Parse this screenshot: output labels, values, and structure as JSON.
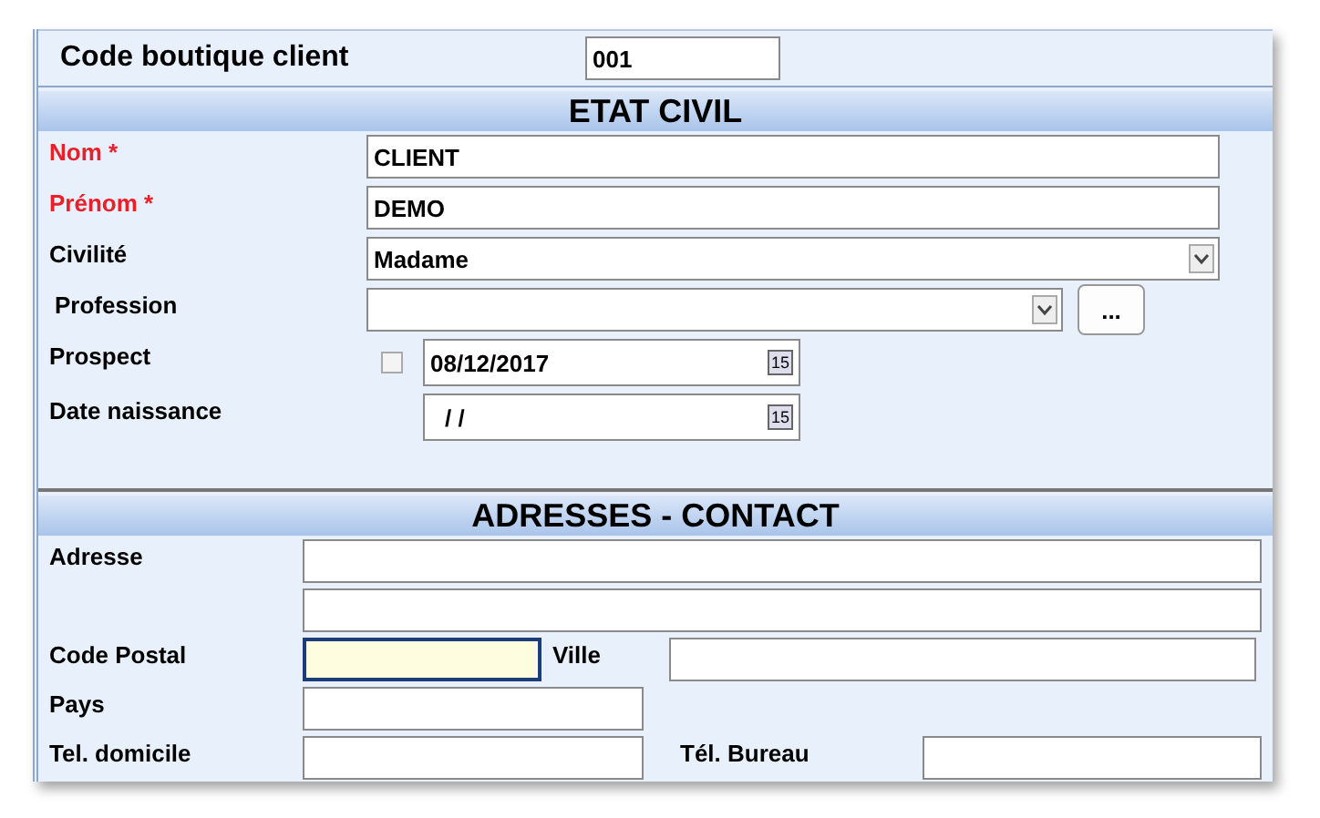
{
  "shop_code": {
    "label": "Code boutique client",
    "value": "001"
  },
  "etat_civil": {
    "title": "ETAT CIVIL",
    "nom": {
      "label": "Nom *",
      "required": true,
      "value": "CLIENT"
    },
    "prenom": {
      "label": "Prénom  *",
      "required": true,
      "value": "DEMO"
    },
    "civilite": {
      "label": "Civilité",
      "required": false,
      "value": "Madame"
    },
    "profession": {
      "label": "Profession",
      "required": false,
      "button": "..."
    },
    "prospect": {
      "label": "Prospect",
      "checked": false,
      "date": "08/12/2017",
      "calendar": "15"
    },
    "date_naissance": {
      "label": "Date naissance",
      "value": "/  /",
      "calendar": "15"
    }
  },
  "adresses": {
    "title": "ADRESSES - CONTACT",
    "adresse": {
      "label": "Adresse"
    },
    "code_postal": {
      "label": "Code Postal",
      "focused": true
    },
    "ville": {
      "label": "Ville"
    },
    "pays": {
      "label": "Pays"
    },
    "tel_domicile": {
      "label": "Tel. domicile"
    },
    "tel_bureau": {
      "label": "Tél. Bureau"
    }
  }
}
